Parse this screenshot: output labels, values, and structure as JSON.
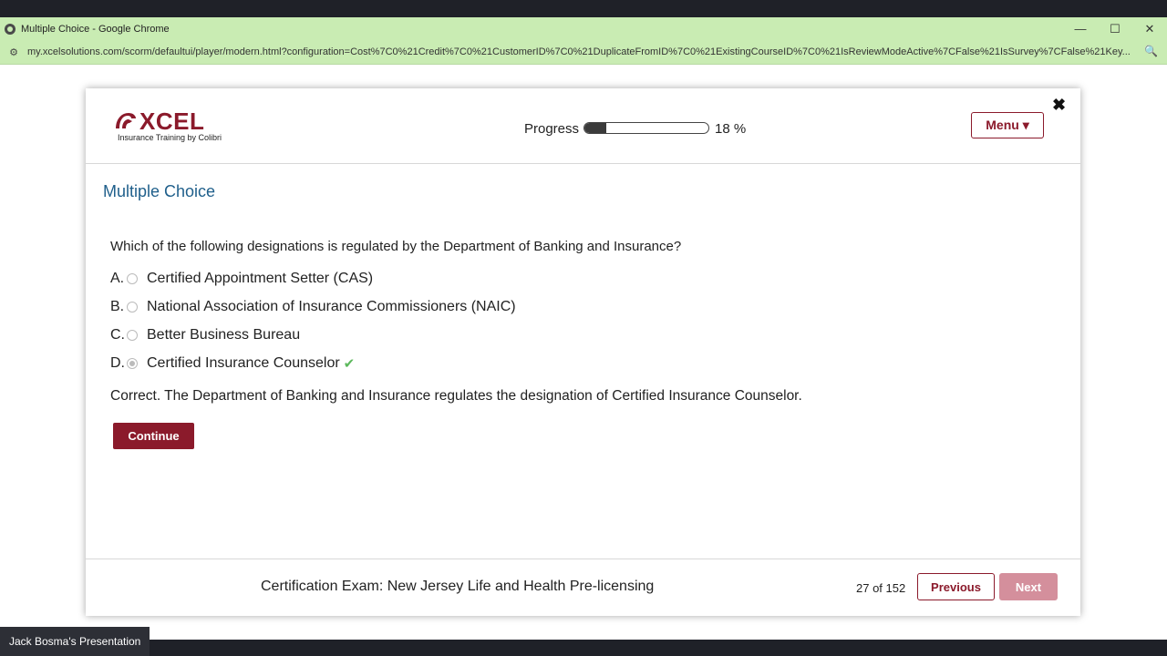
{
  "browser": {
    "title": "Multiple Choice - Google Chrome",
    "url": "my.xcelsolutions.com/scorm/defaultui/player/modern.html?configuration=Cost%7C0%21Credit%7C0%21CustomerID%7C0%21DuplicateFromID%7C0%21ExistingCourseID%7C0%21IsReviewModeActive%7CFalse%21IsSurvey%7CFalse%21Key..."
  },
  "header": {
    "logo_text": "XCEL",
    "logo_sub": "Insurance Training by Colibri",
    "progress_label": "Progress",
    "progress_value": 18,
    "progress_text": "18 %",
    "menu_label": "Menu ▾",
    "close_glyph": "✖"
  },
  "content": {
    "section_title": "Multiple Choice",
    "question": "Which of the following designations is regulated by the Department of Banking and Insurance?",
    "options": [
      {
        "letter": "A.",
        "text": "Certified Appointment Setter (CAS)",
        "selected": false
      },
      {
        "letter": "B.",
        "text": "National Association of Insurance Commissioners (NAIC)",
        "selected": false
      },
      {
        "letter": "C.",
        "text": "Better Business Bureau",
        "selected": false
      },
      {
        "letter": "D.",
        "text": "Certified Insurance Counselor",
        "selected": true,
        "correct_mark": "✔"
      }
    ],
    "feedback": "Correct. The Department of Banking and Insurance regulates the designation of Certified Insurance Counselor.",
    "continue_label": "Continue"
  },
  "footer": {
    "course_name": "Certification Exam: New Jersey Life and Health Pre-licensing",
    "page_count": "27 of 152",
    "previous_label": "Previous",
    "next_label": "Next"
  },
  "presenter": "Jack Bosma's Presentation",
  "colors": {
    "brand": "#8b1a2b",
    "title_blue": "#1f5f8b",
    "check_green": "#5cb85c",
    "chrome_bar": "#c9ecb3"
  }
}
